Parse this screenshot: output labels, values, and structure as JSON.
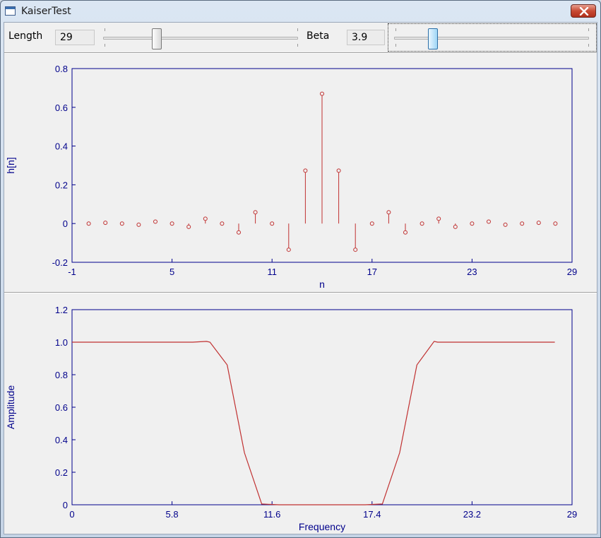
{
  "window": {
    "title": "KaiserTest"
  },
  "controls": {
    "length_label": "Length",
    "length_value": "29",
    "length_slider": {
      "min": 3,
      "max": 99,
      "value": 29
    },
    "beta_label": "Beta",
    "beta_value": "3.9",
    "beta_slider": {
      "min": 0,
      "max": 20,
      "value": 3.9
    }
  },
  "colors": {
    "axis": "#00008b",
    "series": "#c03030",
    "plot_bg": "#f0f0f0"
  },
  "chart_data": [
    {
      "type": "stem",
      "xlabel": "n",
      "ylabel": "h[n]",
      "xlim": [
        -1,
        29
      ],
      "ylim": [
        -0.2,
        0.8
      ],
      "xticks": [
        "-1",
        "5",
        "11",
        "17",
        "23",
        "29"
      ],
      "yticks": [
        "-0.2",
        "0",
        "0.2",
        "0.4",
        "0.6",
        "0.8"
      ],
      "x": [
        0,
        1,
        2,
        3,
        4,
        5,
        6,
        7,
        8,
        9,
        10,
        11,
        12,
        13,
        14,
        15,
        16,
        17,
        18,
        19,
        20,
        21,
        22,
        23,
        24,
        25,
        26,
        27,
        28
      ],
      "values": [
        0,
        0.004,
        0,
        -0.006,
        0.01,
        0,
        -0.017,
        0.025,
        0,
        -0.046,
        0.058,
        0,
        -0.135,
        0.273,
        0.67,
        0.273,
        -0.135,
        0,
        0.058,
        -0.046,
        0,
        0.025,
        -0.017,
        0,
        0.01,
        -0.006,
        0,
        0.004,
        0
      ]
    },
    {
      "type": "line",
      "xlabel": "Frequency",
      "ylabel": "Amplitude",
      "xlim": [
        0,
        29
      ],
      "ylim": [
        0,
        1.2
      ],
      "xticks": [
        "0",
        "5.8",
        "11.6",
        "17.4",
        "23.2",
        "29"
      ],
      "yticks": [
        "0",
        "0.2",
        "0.4",
        "0.6",
        "0.8",
        "1.0",
        "1.2"
      ],
      "x": [
        0,
        1,
        2,
        3,
        4,
        5,
        6,
        7,
        7.8,
        8,
        9,
        10,
        11,
        12,
        13,
        14,
        15,
        16,
        17,
        18,
        19,
        20,
        21,
        21.2,
        22,
        23,
        24,
        25,
        26,
        27,
        28
      ],
      "values": [
        1,
        1,
        1,
        1,
        1,
        1,
        1,
        1,
        1.005,
        1,
        0.86,
        0.32,
        0.005,
        0,
        0,
        0,
        0,
        0,
        0,
        0.005,
        0.32,
        0.86,
        1.005,
        1,
        1,
        1,
        1,
        1,
        1,
        1,
        1
      ]
    }
  ]
}
